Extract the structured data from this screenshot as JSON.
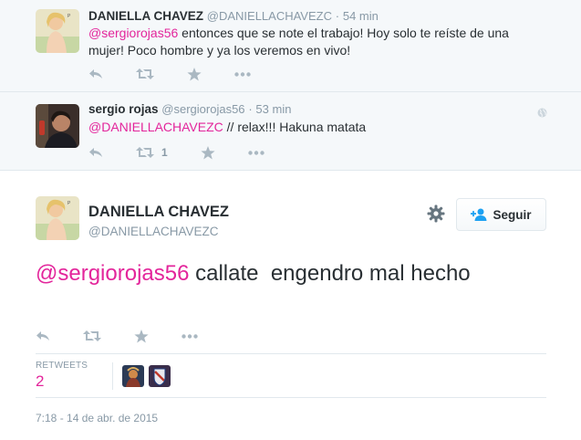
{
  "context_tweet_1": {
    "fullname": "DANIELLA CHAVEZ",
    "screen_name": "@DANIELLACHAVEZC",
    "separator": "·",
    "time": "54 min",
    "mention": "@sergiorojas56",
    "text": " entonces que se note el trabajo! Hoy solo te reíste de una mujer! Poco hombre y ya los veremos en vivo!",
    "actions": [
      "reply-icon",
      "retweet-icon",
      "favorite-icon",
      "more-icon"
    ]
  },
  "context_tweet_2": {
    "fullname": "sergio rojas",
    "screen_name": "@sergiorojas56",
    "separator": "·",
    "time": "53 min",
    "mention": "@DANIELLACHAVEZC",
    "text": " // relax!!! Hakuna matata",
    "retweet_count": "1",
    "actions": [
      "reply-icon",
      "retweet-icon",
      "favorite-icon",
      "more-icon"
    ],
    "globe_icon": "globe-icon"
  },
  "main_tweet": {
    "fullname": "DANIELLA CHAVEZ",
    "screen_name": "@DANIELLACHAVEZC",
    "follow_label": "Seguir",
    "mention": "@sergiorojas56",
    "text": " callate  engendro mal hecho",
    "retweets_label": "RETWEETS",
    "retweets_value": "2",
    "timestamp": "7:18 - 14 de abr. de 2015",
    "actions": [
      "reply-icon",
      "retweet-icon",
      "favorite-icon",
      "more-icon"
    ]
  },
  "colors": {
    "accent": "#e3259b",
    "muted": "#8899a6",
    "icon": "#aab8c2",
    "context_bg": "#f5f8fa",
    "border": "#e1e8ed"
  }
}
